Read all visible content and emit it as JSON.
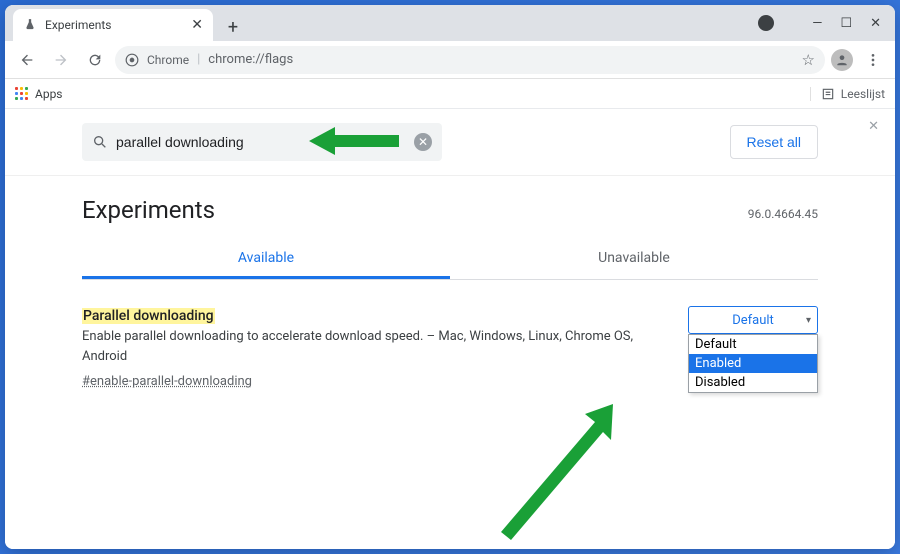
{
  "tab": {
    "title": "Experiments"
  },
  "omnibox": {
    "secure_label": "Chrome",
    "url": "chrome://flags"
  },
  "bookmarks": {
    "apps": "Apps",
    "reading_list": "Leeslijst"
  },
  "search": {
    "value": "parallel downloading"
  },
  "reset": "Reset all",
  "page_title": "Experiments",
  "version": "96.0.4664.45",
  "tabs": {
    "available": "Available",
    "unavailable": "Unavailable"
  },
  "flag": {
    "title": "Parallel downloading",
    "description": "Enable parallel downloading to accelerate download speed. – Mac, Windows, Linux, Chrome OS, Android",
    "anchor": "#enable-parallel-downloading",
    "select_value": "Default",
    "options": {
      "default": "Default",
      "enabled": "Enabled",
      "disabled": "Disabled"
    }
  }
}
